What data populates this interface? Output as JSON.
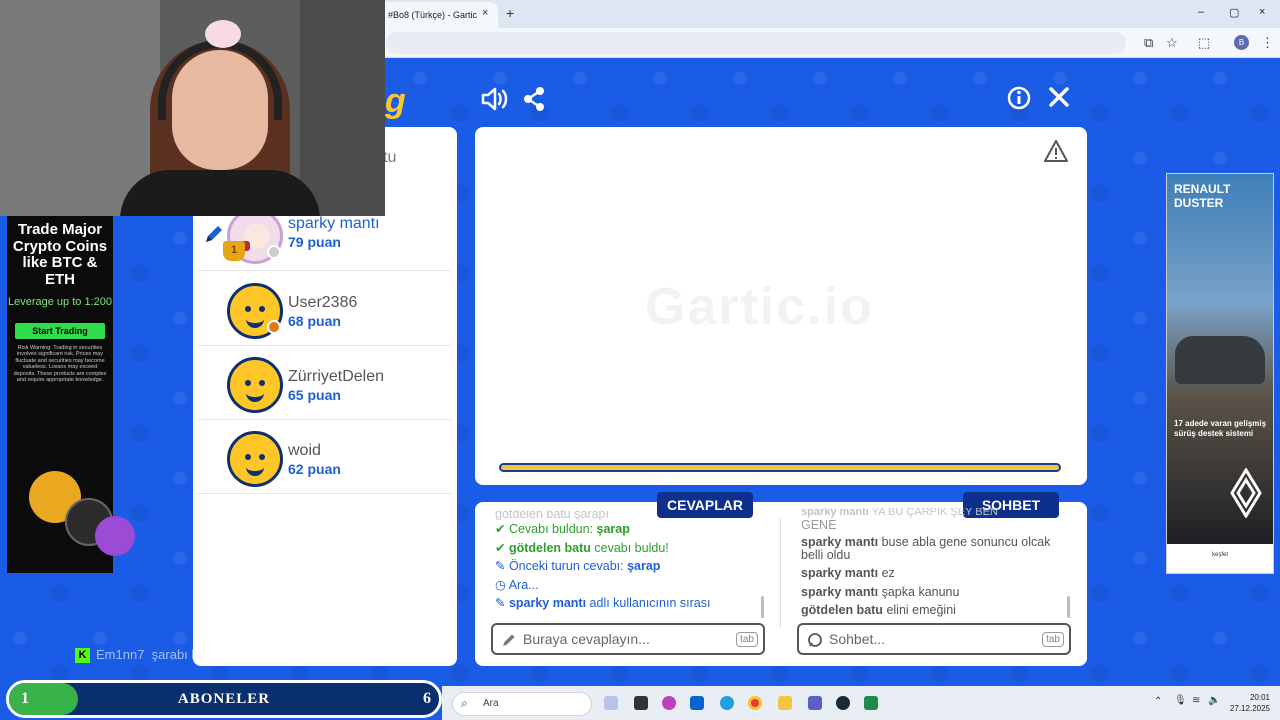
{
  "browser": {
    "tab_title": "#Bo8 (Türkçe) - Gartic",
    "tab_close": "×",
    "tab_add": "+",
    "profile_initial": "B",
    "window_controls": [
      "–",
      "▢",
      "×"
    ]
  },
  "game": {
    "logo_fragment": "g",
    "round_label": "tu",
    "players": [
      {
        "name": "sparky mantı",
        "points": "79 puan",
        "is_drawing": true,
        "rank_badge": "1",
        "status_color": "#cccccc"
      },
      {
        "name": "User2386",
        "points": "68 puan",
        "status_color": "#e07a17"
      },
      {
        "name": "ZürriyetDelen",
        "points": "65 puan"
      },
      {
        "name": "woid",
        "points": "62 puan"
      }
    ],
    "watermark": "Gartic.io",
    "answers_title": "CEVAPLAR",
    "chat_title": "SOHBET",
    "answers_log": [
      {
        "type": "faded",
        "text": "götdelen batu şarapı"
      },
      {
        "type": "correct",
        "prefix": "Cevabı buldun: ",
        "bold": "şarap"
      },
      {
        "type": "found",
        "bold": "götdelen batu",
        "suffix": " cevabı buldu!"
      },
      {
        "type": "info",
        "prefix": "Önceki turun cevabı: ",
        "bold": "şarap"
      },
      {
        "type": "wait",
        "text": "Ara..."
      },
      {
        "type": "turn",
        "bold": "sparky mantı",
        "suffix": " adlı kullanıcının sırası"
      }
    ],
    "chat_log": [
      {
        "user": "sparky mantı",
        "msg": "YA BU ÇARPIK ŞEY BEN",
        "faded": true
      },
      {
        "user": "",
        "msg": "GENE",
        "faded": true
      },
      {
        "user": "sparky mantı",
        "msg": "buse abla gene sonuncu olcak belli oldu"
      },
      {
        "user": "sparky mantı",
        "msg": "ez"
      },
      {
        "user": "sparky mantı",
        "msg": "şapka kanunu"
      },
      {
        "user": "götdelen batu",
        "msg": "elini emeğini"
      }
    ],
    "answer_placeholder": "Buraya cevaplayın...",
    "chat_placeholder": "Sohbet...",
    "tab_key": "tab"
  },
  "ads": {
    "left": {
      "headline": "Trade Major Crypto Coins like BTC & ETH",
      "leverage": "Leverage up to 1:200",
      "cta": "Start Trading",
      "warning": "Risk Warning: Trading in securities involves significant risk. Prices may fluctuate and securities may become valueless. Losses may exceed deposits. These products are complex and require appropriate knowledge."
    },
    "right": {
      "brand": "RENAULT DUSTER",
      "slogan": "17 adede varan gelişmiş sürüş destek sistemi",
      "cta": "keşfet"
    }
  },
  "stream_overlay": {
    "chat_user": "Em1nn7",
    "chat_msg": "şarabı böyle çizdi",
    "sub_left": "1",
    "sub_title": "ABONELER",
    "sub_right": "6",
    "sub_progress": 0.16
  },
  "taskbar": {
    "search": "Ara",
    "time": "20:01",
    "date": "27.12.2025"
  },
  "colors": {
    "game_blue": "#1b5ce6",
    "accent_blue": "#1f5fd6",
    "correct_green": "#2e9e2e",
    "header_navy": "#0f2f8f",
    "timer_yellow": "#f5c542"
  }
}
